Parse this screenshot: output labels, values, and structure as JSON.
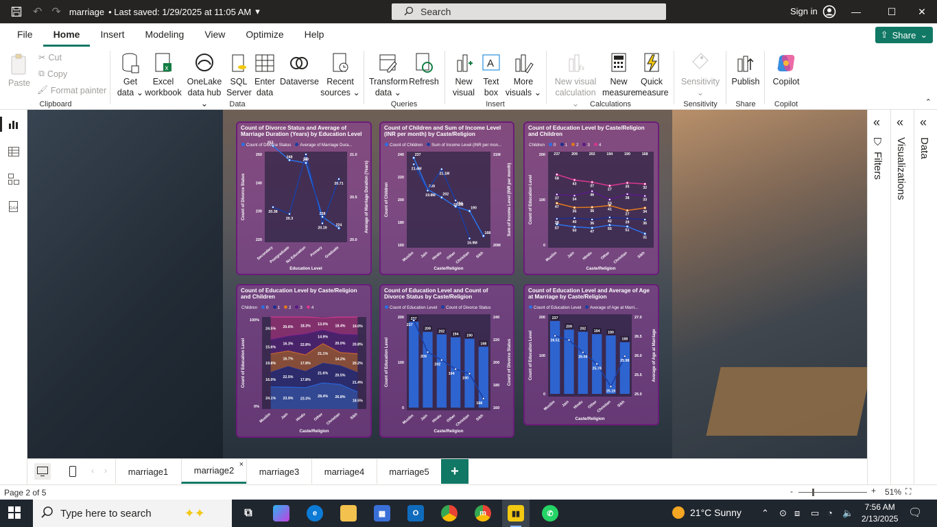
{
  "window": {
    "title": "marriage",
    "saved": "• Last saved: 1/29/2025 at 11:05 AM",
    "search_placeholder": "Search",
    "signin": "Sign in"
  },
  "menu": {
    "items": [
      "File",
      "Home",
      "Insert",
      "Modeling",
      "View",
      "Optimize",
      "Help"
    ],
    "active": "Home",
    "share": "Share"
  },
  "ribbon": {
    "clipboard": {
      "paste": "Paste",
      "cut": "Cut",
      "copy": "Copy",
      "format_painter": "Format painter",
      "label": "Clipboard"
    },
    "data": {
      "get_data": "Get data",
      "excel": "Excel workbook",
      "onelake": "OneLake data hub",
      "sql": "SQL Server",
      "enter": "Enter data",
      "dataverse": "Dataverse",
      "recent": "Recent sources",
      "label": "Data"
    },
    "queries": {
      "transform": "Transform data",
      "refresh": "Refresh",
      "label": "Queries"
    },
    "insert": {
      "new_visual": "New visual",
      "text_box": "Text box",
      "more_visuals": "More visuals",
      "label": "Insert"
    },
    "calculations": {
      "new_visual_calc": "New visual calculation",
      "new_measure": "New measure",
      "quick_measure": "Quick measure",
      "label": "Calculations"
    },
    "sensitivity": {
      "sensitivity": "Sensitivity",
      "label": "Sensitivity"
    },
    "share": {
      "publish": "Publish",
      "label": "Share"
    },
    "copilot": {
      "copilot": "Copilot",
      "label": "Copilot"
    }
  },
  "side_panes": {
    "filters": "Filters",
    "visualizations": "Visualizations",
    "data": "Data"
  },
  "page_tabs": {
    "tabs": [
      "marriage1",
      "marriage2",
      "marriage3",
      "marriage4",
      "marriage5"
    ],
    "active": "marriage2",
    "add": "+"
  },
  "status": {
    "page": "Page 2 of 5",
    "zoom": "51%"
  },
  "taskbar": {
    "search": "Type here to search",
    "weather": "21°C  Sunny",
    "time": "7:56 AM",
    "date": "2/13/2025"
  },
  "chart_data": [
    {
      "type": "line",
      "title": "Count of Divorce Status and Average of Marriage Duration (Years) by Education Level",
      "xlabel": "Education Level",
      "ylabel": "Count of Divorce Status",
      "ylabel2": "Average of Marriage Duration (Years)",
      "categories": [
        "Secondary",
        "Postgraduate",
        "No Education",
        "Primary",
        "Graduate"
      ],
      "series": [
        {
          "name": "Count of Divorce Status",
          "values": [
            253,
            248,
            247,
            228,
            224
          ]
        },
        {
          "name": "Average of Marriage Dura...",
          "values": [
            20.38,
            20.3,
            21.0,
            20.19,
            20.71
          ]
        }
      ],
      "ylim": [
        220,
        250
      ],
      "y2lim": [
        20.0,
        21.0
      ],
      "y_ticks": [
        "250",
        "240",
        "230",
        "220"
      ],
      "y2_ticks": [
        "21.0",
        "20.5",
        "20.0"
      ]
    },
    {
      "type": "line",
      "title": "Count of Children and Sum of Income Level (INR per month) by Caste/Religion",
      "xlabel": "Caste/Religion",
      "ylabel": "Count of Children",
      "ylabel2": "Sum of Income Level (INR per month)",
      "categories": [
        "Muslim",
        "Jain",
        "Hindu",
        "Other",
        "Christian",
        "Sikh"
      ],
      "series": [
        {
          "name": "Count of Children",
          "values": [
            237,
            209,
            202,
            194,
            190,
            168
          ]
        },
        {
          "name": "Sum of Income Level (INR per mon...",
          "values": [
            "21.4M",
            "19.8M",
            "21.1M",
            "19.2M",
            "16.9M"
          ]
        }
      ],
      "ylim": [
        160,
        240
      ],
      "y_ticks": [
        "240",
        "220",
        "200",
        "180",
        "160"
      ],
      "y2_ticks": [
        "21M",
        "20M"
      ]
    },
    {
      "type": "line",
      "title": "Count of Education Level by Caste/Religion and Children",
      "xlabel": "Caste/Religion",
      "ylabel": "Count of Education Level",
      "legend_title": "Children",
      "categories": [
        "Muslim",
        "Jain",
        "Hindu",
        "Other",
        "Christian",
        "Sikh"
      ],
      "series": [
        {
          "name": "0",
          "values": [
            57,
            50,
            47,
            55,
            51,
            31
          ]
        },
        {
          "name": "1",
          "values": [
            38,
            40,
            36,
            42,
            39,
            36
          ]
        },
        {
          "name": "2",
          "values": [
            47,
            35,
            36,
            41,
            27,
            34
          ]
        },
        {
          "name": "3",
          "values": [
            37,
            34,
            46,
            23,
            38,
            33
          ]
        },
        {
          "name": "4",
          "values": [
            58,
            43,
            37,
            27,
            35,
            32
          ]
        }
      ],
      "totals": [
        237,
        209,
        202,
        194,
        190,
        168
      ],
      "y_ticks": [
        "200",
        "100",
        "0"
      ]
    },
    {
      "type": "area",
      "title": "Count of Education Level by Caste/Religion and Children",
      "xlabel": "Caste/Religion",
      "ylabel": "Count of Education Level",
      "legend_title": "Children",
      "categories": [
        "Muslim",
        "Jain",
        "Hindu",
        "Other",
        "Christian",
        "Sikh"
      ],
      "series": [
        {
          "name": "0",
          "values": [
            "24.1%",
            "23.9%",
            "23.3%",
            "28.4%",
            "26.8%",
            "18.5%"
          ]
        },
        {
          "name": "1",
          "values": [
            "16.0%",
            "22.5%",
            "17.8%",
            "21.6%",
            "20.5%",
            "21.4%"
          ]
        },
        {
          "name": "2",
          "values": [
            "19.8%",
            "16.7%",
            "17.8%",
            "21.1%",
            "14.2%",
            "20.2%"
          ]
        },
        {
          "name": "3",
          "values": [
            "15.6%",
            "16.3%",
            "22.8%",
            "14.9%",
            "20.0%",
            "20.8%"
          ]
        },
        {
          "name": "4",
          "values": [
            "24.5%",
            "20.6%",
            "18.3%",
            "13.0%",
            "18.4%",
            "19.0%"
          ]
        }
      ],
      "y_ticks": [
        "100%",
        "0%"
      ]
    },
    {
      "type": "bar",
      "title": "Count of Education Level and Count of Divorce Status by Caste/Religion",
      "xlabel": "Caste/Religion",
      "ylabel": "Count of Education Level",
      "ylabel2": "Count of Divorce Status",
      "categories": [
        "Muslim",
        "Jain",
        "Hindu",
        "Other",
        "Christian",
        "Sikh"
      ],
      "series": [
        {
          "name": "Count of Education Level",
          "values": [
            237,
            209,
            202,
            194,
            190,
            168
          ]
        },
        {
          "name": "Count of Divorce Status",
          "values": [
            237,
            209,
            202,
            194,
            190,
            168
          ]
        }
      ],
      "y_ticks": [
        "200",
        "100",
        "0"
      ],
      "y2_ticks": [
        "240",
        "220",
        "200",
        "180",
        "160"
      ]
    },
    {
      "type": "bar",
      "title": "Count of Education Level and Average of Age at Marriage by Caste/Religion",
      "xlabel": "Caste/Religion",
      "ylabel": "Count of Education Level",
      "ylabel2": "Average of Age at Marriage",
      "categories": [
        "Muslim",
        "Jain",
        "Hindu",
        "Other",
        "Christian",
        "Sikh"
      ],
      "series": [
        {
          "name": "Count of Education Level",
          "values": [
            237,
            209,
            202,
            194,
            190,
            168
          ]
        },
        {
          "name": "Average of Age at Marri...",
          "values": [
            26.51,
            26.4,
            26.08,
            25.78,
            25.19,
            25.98
          ]
        }
      ],
      "y_ticks": [
        "200",
        "100",
        "0"
      ],
      "y2_ticks": [
        "27.0",
        "26.5",
        "26.0",
        "25.5",
        "25.0"
      ]
    }
  ]
}
